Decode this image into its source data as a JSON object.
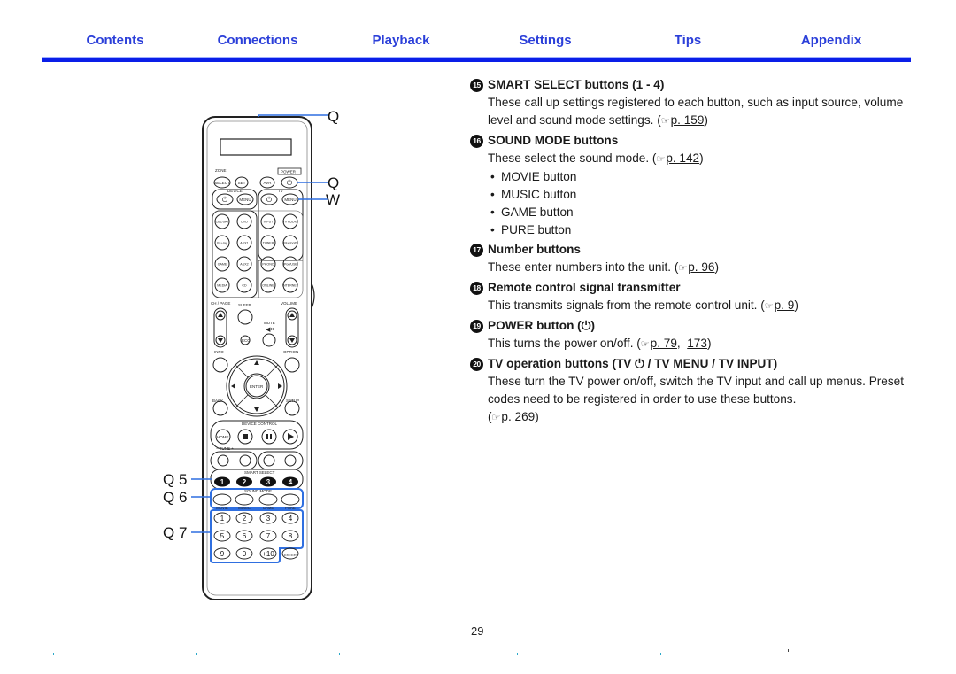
{
  "nav": {
    "tabs": [
      {
        "label": "Contents"
      },
      {
        "label": "Connections"
      },
      {
        "label": "Playback"
      },
      {
        "label": "Settings"
      },
      {
        "label": "Tips"
      },
      {
        "label": "Appendix"
      }
    ],
    "accent_color": "#2b3fd9",
    "rule_color": "#0a1ee8"
  },
  "sections": [
    {
      "number": "15",
      "title": "SMART SELECT buttons (1 - 4)",
      "body": "These call up settings registered to each button, such as input source, volume level and sound mode settings.",
      "refs": [
        "p. 159"
      ]
    },
    {
      "number": "16",
      "title": "SOUND MODE buttons",
      "body": "These select the sound mode.",
      "refs": [
        "p. 142"
      ],
      "bullets": [
        "MOVIE button",
        "MUSIC button",
        "GAME button",
        "PURE button"
      ]
    },
    {
      "number": "17",
      "title": "Number buttons",
      "body": "These enter numbers into the unit.",
      "refs": [
        "p. 96"
      ]
    },
    {
      "number": "18",
      "title": "Remote control signal transmitter",
      "body": "This transmits signals from the remote control unit.",
      "refs": [
        "p. 9"
      ]
    },
    {
      "number": "19",
      "title": "POWER button (⏻)",
      "body": "This turns the power on/off.",
      "refs": [
        "p. 79",
        "173"
      ]
    },
    {
      "number": "20",
      "title": "TV operation buttons (TV ⏻ / TV MENU / TV INPUT)",
      "body": "These turn the TV power on/off, switch the TV input and call up menus. Preset codes need to be registered in order to use these buttons.",
      "refs": [
        "p. 269"
      ]
    }
  ],
  "ref_icon": "hand-pointer-icon",
  "callouts": {
    "transmitter": "Q",
    "power": "Q",
    "tv": "W",
    "smart_select": "Q 5",
    "sound_mode": "Q 6",
    "numbers": "Q 7"
  },
  "remote": {
    "labels": {
      "zone": "ZONE",
      "power": "POWER",
      "device": "DEVICE",
      "tv": "TV",
      "ch_page": "CH / PAGE",
      "sleep": "SLEEP",
      "volume": "VOLUME",
      "mute": "MUTE",
      "info": "INFO",
      "option": "OPTION",
      "back": "BACK",
      "setup": "SETUP",
      "device_control": "DEVICE CONTROL",
      "tune": "−  TUNE  +",
      "smart_select": "SMART SELECT",
      "sound_mode": "SOUND MODE"
    },
    "zone_row": [
      "SELECT",
      "SET",
      "AVR",
      "⏻"
    ],
    "device_row": [
      "⏻",
      "MENU",
      "⏻",
      "MENU"
    ],
    "source_rows": [
      [
        "CBL/SAT",
        "DVD",
        "INPUT",
        "TV AUDIO"
      ],
      [
        "Blu-ray",
        "AUX1",
        "TUNER",
        "Bluetooth"
      ],
      [
        "GAME",
        "AUX2",
        "PHONO",
        "iPod/USB"
      ],
      [
        "MEDIA PLAYER",
        "CD",
        "ONLINE MUSIC",
        "INTERNET RADIO"
      ]
    ],
    "eco": "ECO",
    "enter": "ENTER",
    "home": "HOME",
    "smart_buttons": [
      "1",
      "2",
      "3",
      "4"
    ],
    "sound_mode_names": [
      "MOVIE",
      "MUSIC",
      "GAME",
      "PURE"
    ],
    "number_rows": [
      [
        "1",
        "2",
        "3",
        "4"
      ],
      [
        "5",
        "6",
        "7",
        "8"
      ],
      [
        "9",
        "0",
        "+10",
        "ENTER"
      ]
    ]
  },
  "footer": {
    "page_number": "29"
  }
}
